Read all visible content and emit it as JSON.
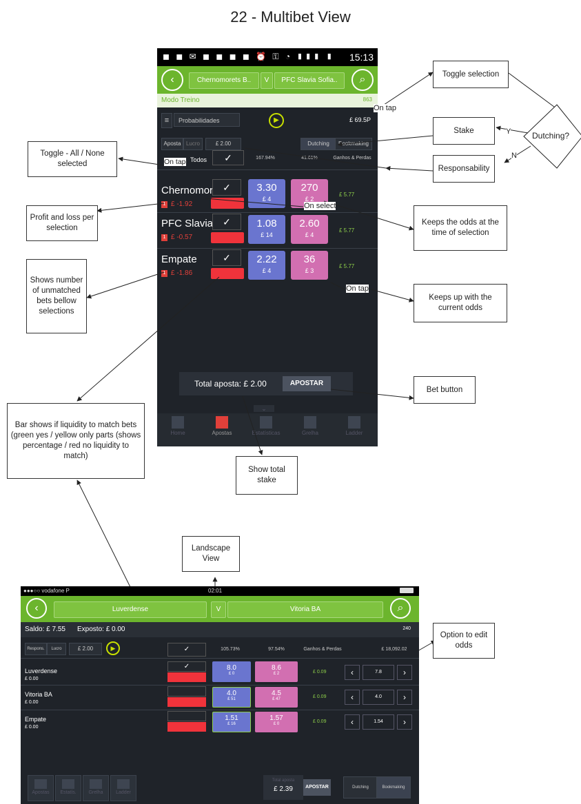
{
  "page_title": "22 - Multibet View",
  "portrait": {
    "status_icons": "◼ ◼ ✉ ◼ ◼ ◼ ◼   ⏰ ⚿ ◔ ▮▮▮ ▮",
    "status_time": "15:13",
    "team_home": "Chernomorets B..",
    "vs": "V",
    "team_away": "PFC Slavia Sofia..",
    "mode": "Modo Treino",
    "mode_count": "863",
    "market": "Probabilidades",
    "balance": "£ 69.5P",
    "stake_label": "Aposta",
    "stake_tab2": "Lucro",
    "stake_value": "£ 2.00",
    "dutching": "Dutching",
    "bookmaking": "Bookmaking",
    "all_label": "Todos",
    "back_pct": "167.94%",
    "lay_pct": "41.61%",
    "pl_header": "Ganhos & Perdas",
    "rows": [
      {
        "name": "Chernomor",
        "badge": "1",
        "pl": "£ -1.92",
        "check": "✓",
        "back": "3.30",
        "back_stake": "£ 4",
        "lay": "270",
        "lay_stake": "£ 2",
        "profit": "£ 5.77"
      },
      {
        "name": "PFC Slavia",
        "badge": "1",
        "pl": "£ -0.57",
        "check": "✓",
        "back": "1.08",
        "back_stake": "£ 14",
        "lay": "2.60",
        "lay_stake": "£ 4",
        "profit": "£ 5.77"
      },
      {
        "name": "Empate",
        "badge": "1",
        "pl": "£ -1.86",
        "check": "✓",
        "back": "2.22",
        "back_stake": "£ 4",
        "lay": "36",
        "lay_stake": "£ 3",
        "profit": "£ 5.77"
      }
    ],
    "total_label": "Total aposta: £ 2.00",
    "bet_button": "APOSTAR",
    "collapse": "⌄",
    "nav": [
      "Home",
      "Apostas",
      "Estatísticas",
      "Grelha",
      "Ladder"
    ]
  },
  "annotations": {
    "toggle_selection": "Toggle selection",
    "on_tap_top": "On tap",
    "stake": "Stake",
    "y": "Y",
    "dutching_q": "Dutching?",
    "n": "N",
    "responsability": "Responsability",
    "toggle_all": "Toggle - All / None selected",
    "on_tap_all": "On tap",
    "profit_loss": "Profit and loss per selection",
    "on_select": "On select",
    "keeps_odds": "Keeps the odds at the time of selection",
    "unmatched": "Shows number of unmatched bets bellow selections",
    "on_tap_lay": "On tap",
    "keeps_current": "Keeps up with the current odds",
    "bet_button": "Bet button",
    "liquidity": "Bar shows if liquidity to match bets (green yes / yellow only parts (shows percentage / red no liquidity to match)",
    "total_stake": "Show total stake",
    "landscape": "Landscape View",
    "edit_odds": "Option to edit odds"
  },
  "landscape": {
    "carrier": "●●●○○ vodafone P",
    "time": "02:01",
    "team_home": "Luverdense",
    "vs": "V",
    "team_away": "Vitoria BA",
    "saldo": "Saldo: £ 7.55",
    "exposto": "Exposto: £ 0.00",
    "count": "240",
    "resp": "Respons.",
    "lucro": "Lucro",
    "stake": "£ 2.00",
    "back_pct": "105.73%",
    "lay_pct": "97.54%",
    "pl_header": "Ganhos & Perdas",
    "balance_right": "£ 18,092.02",
    "rows": [
      {
        "name": "Luverdense",
        "pl": "£ 0.00",
        "check": "✓",
        "back": "8.0",
        "back_stake": "£ 0",
        "lay": "8.6",
        "lay_stake": "£ 2",
        "profit": "£ 0.09",
        "edit": "7.8"
      },
      {
        "name": "Vitoria BA",
        "pl": "£ 0.00",
        "check": "",
        "back": "4.0",
        "back_stake": "£ 51",
        "lay": "4.5",
        "lay_stake": "£ 47",
        "profit": "£ 0.09",
        "edit": "4.0"
      },
      {
        "name": "Empate",
        "pl": "£ 0.00",
        "check": "",
        "back": "1.51",
        "back_stake": "£ 16",
        "lay": "1.57",
        "lay_stake": "£ 0",
        "profit": "£ 0.09",
        "edit": "1.54"
      }
    ],
    "total_label": "Total aposta",
    "total_value": "£ 2.39",
    "bet_button": "APOSTAR",
    "dutching": "Dutching",
    "bookmaking": "Bookmaking",
    "nav": [
      "Apostas",
      "Estatís.",
      "Grelha",
      "Ladder"
    ]
  }
}
